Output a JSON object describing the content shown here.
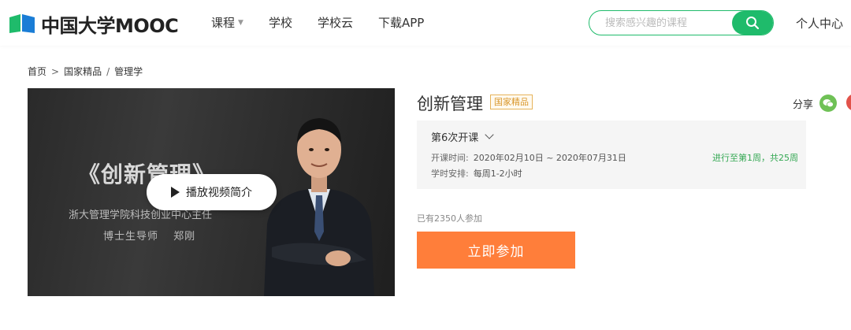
{
  "header": {
    "logo_text": "中国大学MOOC",
    "nav": [
      {
        "label": "课程",
        "has_dropdown": true
      },
      {
        "label": "学校",
        "has_dropdown": false
      },
      {
        "label": "学校云",
        "has_dropdown": false
      },
      {
        "label": "下载APP",
        "has_dropdown": false
      }
    ],
    "search_placeholder": "搜索感兴趣的课程",
    "user_center": "个人中心",
    "accent_color": "#1fbb6b"
  },
  "breadcrumb": {
    "home": "首页",
    "separator": ">",
    "category": "国家精品",
    "slash": "/",
    "subject": "管理学"
  },
  "video": {
    "title": "《创新管理》",
    "subtitle_line1": "浙大管理学院科技创业中心主任",
    "subtitle_line2": "博士生导师　 郑刚",
    "play_label": "播放视频简介"
  },
  "course": {
    "title": "创新管理",
    "tag": "国家精品",
    "share_label": "分享",
    "term": {
      "selected": "第6次开课",
      "dates_key": "开课时间:",
      "dates_value": "2020年02月10日 ~ 2020年07月31日",
      "hours_key": "学时安排:",
      "hours_value": "每周1-2小时",
      "progress": "进行至第1周，共25周"
    },
    "enrolled": "已有2350人参加",
    "join_label": "立即参加",
    "join_color": "#ff7e3a"
  }
}
